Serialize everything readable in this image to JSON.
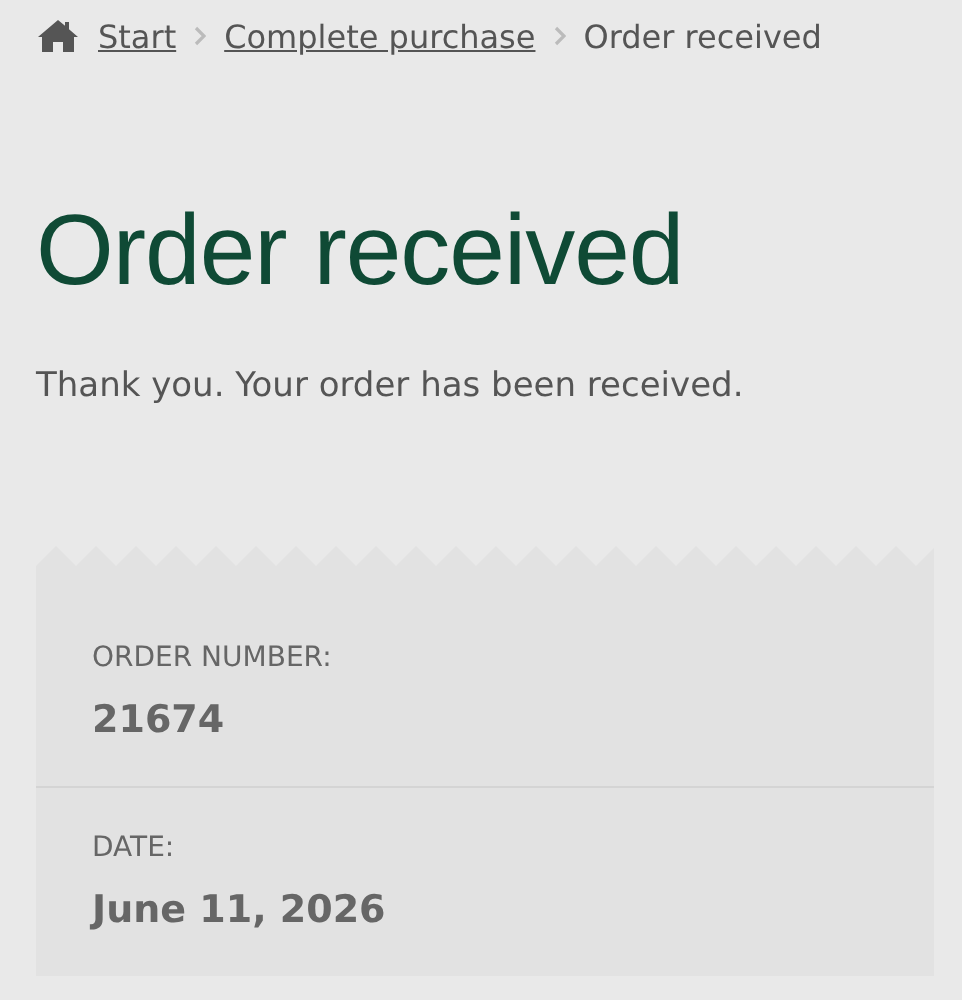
{
  "breadcrumbs": [
    {
      "label": "Start",
      "current": false
    },
    {
      "label": "Complete purchase",
      "current": false
    },
    {
      "label": "Order received",
      "current": true
    }
  ],
  "title": "Order received",
  "message": "Thank you. Your order has been received.",
  "order_details": [
    {
      "label": "ORDER NUMBER:",
      "value": "21674"
    },
    {
      "label": "DATE:",
      "value": "June 11, 2026"
    }
  ]
}
